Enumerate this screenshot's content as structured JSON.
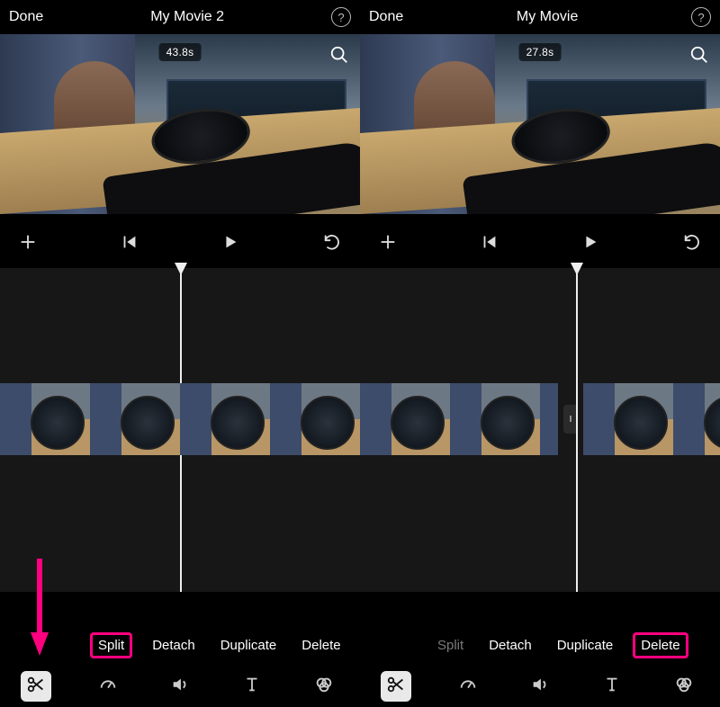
{
  "left": {
    "done": "Done",
    "title": "My Movie 2",
    "timestamp": "43.8s",
    "actions": {
      "split": "Split",
      "detach": "Detach",
      "duplicate": "Duplicate",
      "delete": "Delete"
    }
  },
  "right": {
    "done": "Done",
    "title": "My Movie",
    "timestamp": "27.8s",
    "actions": {
      "split": "Split",
      "detach": "Detach",
      "duplicate": "Duplicate",
      "delete": "Delete"
    }
  },
  "audio_end_marker": "I"
}
